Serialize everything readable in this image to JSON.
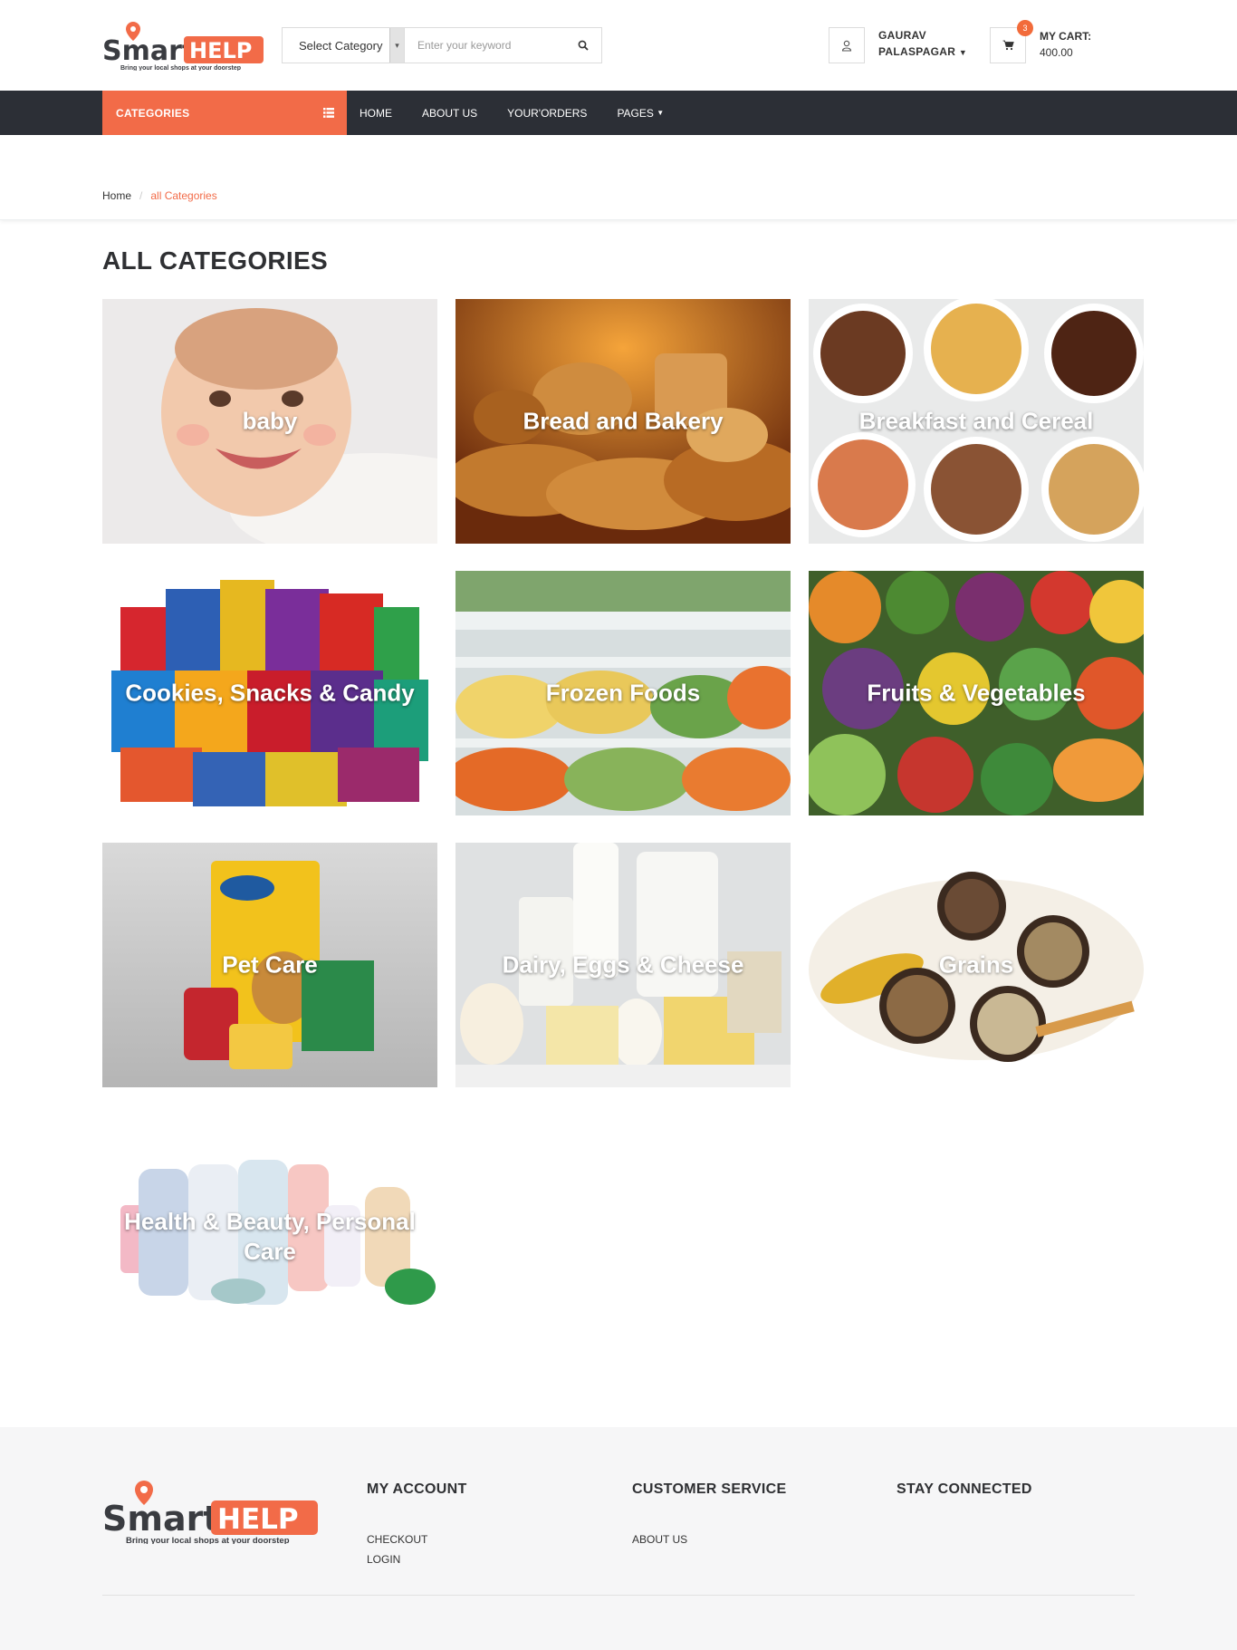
{
  "brand": {
    "name_smart": "Smart",
    "name_help": "HELP",
    "tagline": "Bring your local shops at your doorstep",
    "accent": "#f26b48",
    "dark": "#2c2f36"
  },
  "search": {
    "category_label": "Select Category",
    "placeholder": "Enter your keyword",
    "button_icon": "search-icon"
  },
  "user": {
    "first": "GAURAV",
    "last": "PALASPAGAR",
    "icon": "user-icon"
  },
  "cart": {
    "count": "3",
    "label": "MY CART:",
    "amount": "400.00",
    "icon": "cart-icon"
  },
  "nav": {
    "categories": "CATEGORIES",
    "links": [
      "HOME",
      "ABOUT US",
      "YOUR'ORDERS",
      "PAGES"
    ]
  },
  "breadcrumb": {
    "home": "Home",
    "separator": "/",
    "current": "all Categories"
  },
  "page_title": "ALL CATEGORIES",
  "categories": [
    "baby",
    "Bread and Bakery",
    "Breakfast and Cereal",
    "Cookies, Snacks & Candy",
    "Frozen Foods",
    "Fruits & Vegetables",
    "Pet Care",
    "Dairy, Eggs & Cheese",
    "Grains",
    "Health & Beauty, Personal Care"
  ],
  "footer": {
    "my_account": {
      "title": "MY ACCOUNT",
      "items": [
        "CHECKOUT",
        "LOGIN"
      ]
    },
    "customer_service": {
      "title": "CUSTOMER SERVICE",
      "items": [
        "ABOUT US"
      ]
    },
    "stay_connected": {
      "title": "STAY CONNECTED"
    }
  }
}
